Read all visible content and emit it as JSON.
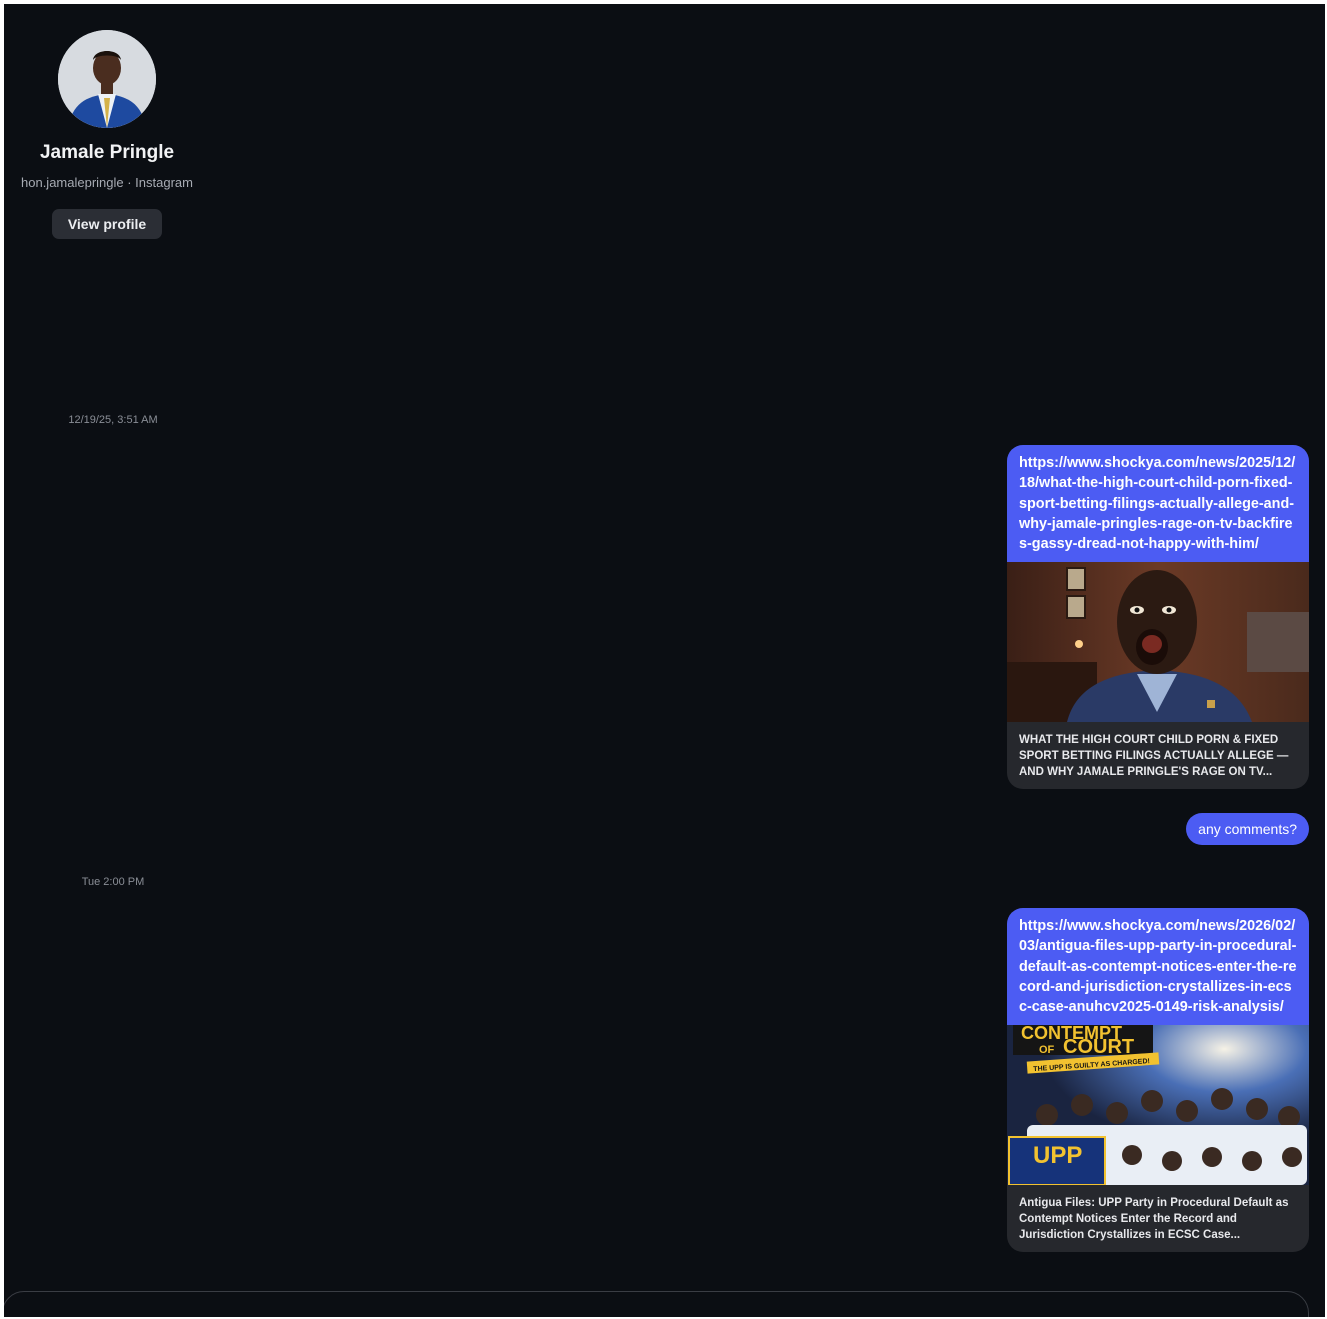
{
  "profile": {
    "name": "Jamale Pringle",
    "subtitle": "hon.jamalepringle · Instagram",
    "view_profile_label": "View profile",
    "avatar_icon": "profile-photo"
  },
  "messages": {
    "timestamp_1": "12/19/25, 3:51 AM",
    "timestamp_2": "Tue 2:00 PM",
    "card_1": {
      "link": "https://www.shockya.com/news/2025/12/18/what-the-high-court-child-porn-fixed-sport-betting-filings-actually-allege-and-why-jamale-pringles-rage-on-tv-backfires-gassy-dread-not-happy-with-him/",
      "caption": "WHAT THE HIGH COURT CHILD PORN & FIXED SPORT BETTING FILINGS ACTUALLY ALLEGE — AND WHY JAMALE PRINGLE'S RAGE ON TV..."
    },
    "reply_1": "any comments?",
    "card_2": {
      "link": "https://www.shockya.com/news/2026/02/03/antigua-files-upp-party-in-procedural-default-as-contempt-notices-enter-the-record-and-jurisdiction-crystallizes-in-ecsc-case-anuhcv2025-0149-risk-analysis/",
      "caption": "Antigua Files: UPP Party in Procedural Default as Contempt Notices Enter the Record and Jurisdiction Crystallizes in ECSC Case...",
      "image_text": {
        "title_1": "CONTEMPT",
        "title_of": "OF",
        "title_2": "COURT",
        "banner": "THE UPP IS GUILTY AS CHARGED!",
        "logo": "UPP"
      }
    }
  },
  "colors": {
    "background": "#0b0e13",
    "accent": "#4c5cf3",
    "card_bg": "#26282d"
  }
}
